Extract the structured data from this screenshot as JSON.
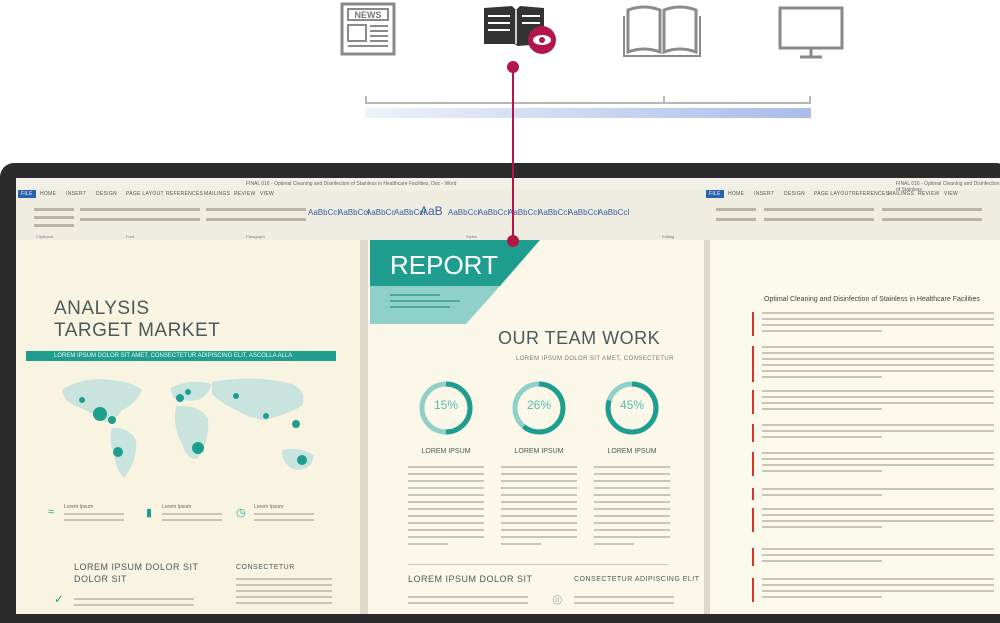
{
  "top_icons": [
    {
      "name": "news",
      "label": "NEWS",
      "active": false
    },
    {
      "name": "reader",
      "active": true
    },
    {
      "name": "book",
      "active": false
    },
    {
      "name": "monitor",
      "active": false
    }
  ],
  "colors": {
    "accent": "#b3174a",
    "teal": "#1f9e90",
    "teal_light": "#8fd0c8",
    "bar": "#b7c8ea",
    "ribbon_blue": "#2a62b0"
  },
  "word_left": {
    "tabs": [
      "FILE",
      "HOME",
      "INSERT",
      "DESIGN",
      "PAGE LAYOUT",
      "REFERENCES",
      "MAILINGS",
      "REVIEW",
      "VIEW"
    ],
    "title": "FINAL 016 - Optimal Cleaning and Disinfection of Stainless in Healthcare Facilities, Doc - Word"
  },
  "word_right": {
    "tabs": [
      "FILE",
      "HOME",
      "INSERT",
      "DESIGN",
      "PAGE LAYOUT",
      "REFERENCES",
      "MAILINGS",
      "REVIEW",
      "VIEW"
    ],
    "title": "FINAL 016 - Optimal Cleaning and Disinfection of Stainless"
  },
  "ribbon_styles": [
    "AaBbCcI",
    "AaBbCcI",
    "AaBbCc",
    "AaBbCcI",
    "AaB",
    "AaBbCcI",
    "AaBbCcI",
    "AaBbCcI",
    "AaBbCcI",
    "AaBbCcI",
    "AaBbCcI"
  ],
  "ribbon_groups": [
    "Clipboard",
    "Font",
    "Paragraph",
    "Styles",
    "Editing"
  ],
  "left_page": {
    "title_line1": "ANALYSIS",
    "title_line2": "TARGET MARKET",
    "banner": "LOREM IPSUM DOLOR SIT AMET, CONSECTETUR ADIPISCING ELIT, ASCOLLA ALLA",
    "stats": [
      "Lorem Ipsum",
      "Lorem Ipsum",
      "Lorem Ipsum"
    ],
    "section_left": "LOREM IPSUM DOLOR SIT",
    "section_left2": "DOLOR SIT",
    "section_right": "CONSECTETUR"
  },
  "mid_page": {
    "report": "REPORT",
    "team_title": "OUR TEAM WORK",
    "team_sub": "LOREM IPSUM DOLOR SIT AMET, CONSECTETUR",
    "circles": [
      {
        "label": "15%",
        "value": 15,
        "caption": "LOREM IPSUM"
      },
      {
        "label": "26%",
        "value": 26,
        "caption": "LOREM IPSUM"
      },
      {
        "label": "45%",
        "value": 45,
        "caption": "LOREM IPSUM"
      }
    ],
    "bottom_left": "LOREM IPSUM DOLOR SIT",
    "bottom_right": "CONSECTETUR ADIPISCING ELIT"
  },
  "right_page": {
    "title": "Optimal Cleaning and Disinfection of Stainless in Healthcare Facilities"
  }
}
